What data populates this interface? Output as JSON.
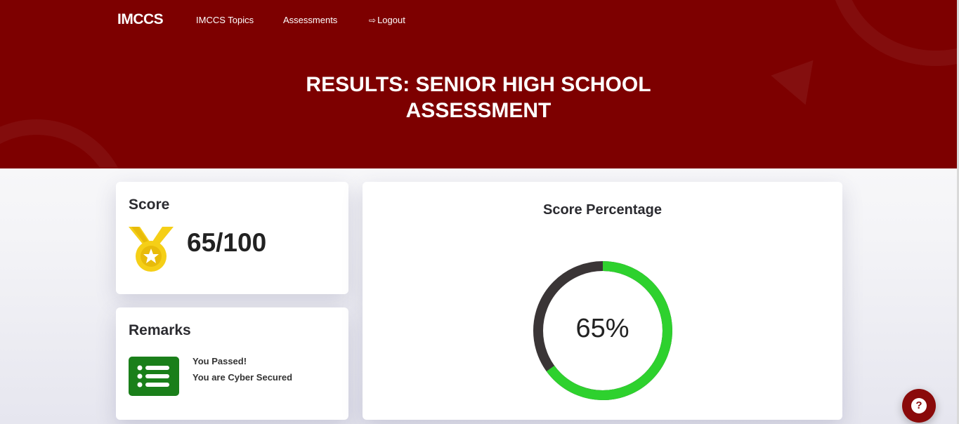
{
  "nav": {
    "logo": "IMCCS",
    "items": [
      {
        "label": "IMCCS Topics"
      },
      {
        "label": "Assessments"
      },
      {
        "label": "Logout",
        "icon": "logout-icon"
      }
    ]
  },
  "header": {
    "title_line1": "RESULTS: SENIOR HIGH SCHOOL",
    "title_line2": "ASSESSMENT"
  },
  "score_card": {
    "title": "Score",
    "value": "65/100",
    "icon": "medal-icon"
  },
  "remarks_card": {
    "title": "Remarks",
    "icon": "list-icon",
    "lines": [
      "You Passed!",
      "You are Cyber Secured"
    ]
  },
  "percentage_card": {
    "title": "Score Percentage",
    "percent_label": "65%",
    "percent_value": 65
  },
  "help": {
    "label": "?",
    "icon": "help-icon"
  },
  "colors": {
    "brand": "#7d0000",
    "progress": "#2ed12e",
    "track": "#3a3536",
    "medal": "#f5cf17",
    "badge": "#1a7f1a"
  }
}
